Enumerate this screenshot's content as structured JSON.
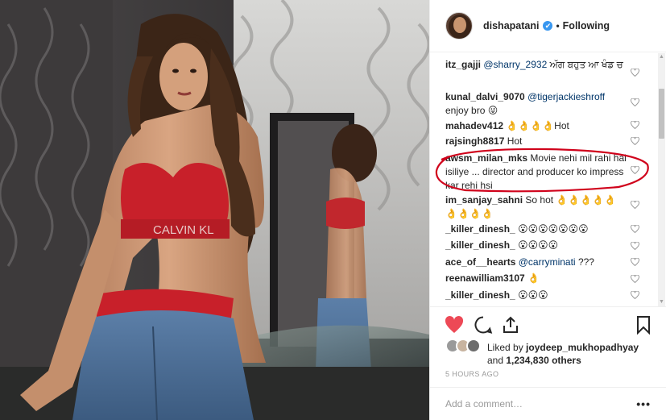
{
  "post": {
    "username": "dishapatani",
    "verified_badge": "✔",
    "separator": "•",
    "follow_status": "Following"
  },
  "photo": {
    "brand_text": "CALVIN KL"
  },
  "comments": [
    {
      "user": "itz_gajji",
      "mention": "@sharry_2932",
      "text": "ਅੱਗ ਬਹੁਤ ਆ ਖੰਡ ਚ"
    },
    {
      "user": "kunal_dalvi_9070",
      "mention": "@tigerjackieshroff",
      "text": "enjoy bro 😜"
    },
    {
      "user": "mahadev412",
      "mention": "",
      "text": "👌👌👌👌Hot"
    },
    {
      "user": "rajsingh8817",
      "mention": "",
      "text": "Hot"
    },
    {
      "user": "awsm_milan_mks",
      "mention": "",
      "text": "Movie nehi mil rahi hai isiliye ... director and producer ko impress kar rehi hsi"
    },
    {
      "user": "im_sanjay_sahni",
      "mention": "",
      "text": "So hot 👌👌👌👌👌👌👌👌👌"
    },
    {
      "user": "_killer_dinesh_",
      "mention": "",
      "text": "😮😮😮😮😮😮😮"
    },
    {
      "user": "_killer_dinesh_",
      "mention": "",
      "text": "😮😮😮😮"
    },
    {
      "user": "ace_of__hearts",
      "mention": "@carryminati",
      "text": "???"
    },
    {
      "user": "reenawilliam3107",
      "mention": "",
      "text": "👌"
    },
    {
      "user": "_killer_dinesh_",
      "mention": "",
      "text": "😮😮😮"
    }
  ],
  "likes": {
    "prefix": "Liked by",
    "top_liker": "joydeep_mukhopadhyay",
    "and": "and",
    "others": "1,234,830 others"
  },
  "timestamp": "5 HOURS AGO",
  "add_comment": {
    "placeholder": "Add a comment…",
    "more": "•••"
  },
  "colors": {
    "like_red": "#ed4956",
    "annotation_red": "#d0021b",
    "verified_blue": "#3897f0"
  },
  "icons": [
    "heart-filled-icon",
    "comment-icon",
    "share-icon",
    "bookmark-icon",
    "small-heart-icon"
  ]
}
